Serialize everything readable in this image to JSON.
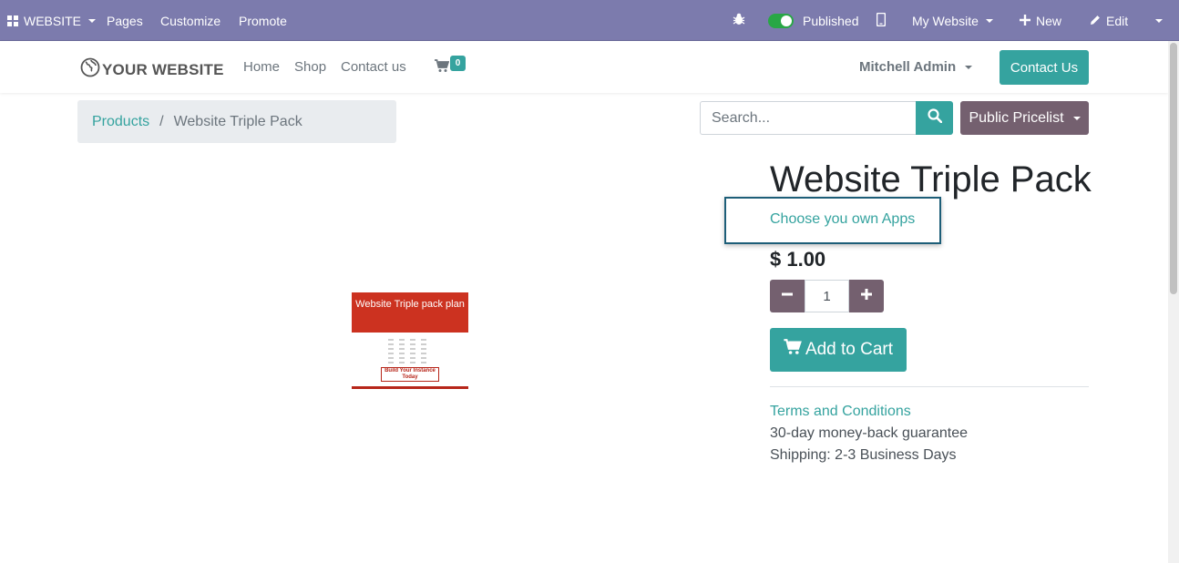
{
  "admin_bar": {
    "app_label": "WEBSITE",
    "menu": [
      "Pages",
      "Customize",
      "Promote"
    ],
    "published_label": "Published",
    "published_state": true,
    "site_selector": "My Website",
    "new_label": "New",
    "edit_label": "Edit"
  },
  "header": {
    "logo_text": "YOUR WEBSITE",
    "nav": [
      "Home",
      "Shop",
      "Contact us"
    ],
    "cart_count": "0",
    "user_name": "Mitchell Admin",
    "contact_button": "Contact Us"
  },
  "breadcrumb": {
    "parent": "Products",
    "separator": "/",
    "current": "Website Triple Pack"
  },
  "search": {
    "placeholder": "Search...",
    "value": ""
  },
  "pricelist": {
    "label": "Public Pricelist"
  },
  "product": {
    "name": "Website Triple Pack",
    "subtitle": "Choose you own Apps",
    "price": "$ 1.00",
    "quantity": "1",
    "add_to_cart_label": "Add to Cart",
    "terms_label": "Terms and Conditions",
    "guarantee": "30-day money-back guarantee",
    "shipping": "Shipping: 2-3 Business Days",
    "image": {
      "headline": "Website Triple pack plan",
      "caption": "Build Your Instance Today"
    }
  },
  "colors": {
    "admin_bar": "#7c7bad",
    "primary": "#35a39f",
    "secondary": "#74606f",
    "highlight_border": "#1d5e78"
  }
}
